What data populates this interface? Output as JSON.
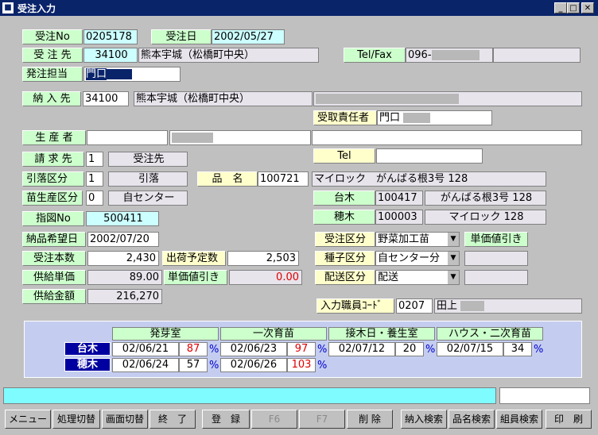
{
  "window": {
    "title": "受注入力"
  },
  "header": {
    "order_no_label": "受注No",
    "order_no": "0205178",
    "order_date_label": "受注日",
    "order_date": "2002/05/27",
    "customer_label": "受 注 先",
    "customer_code": "34100",
    "customer_name": "熊本宇城（松橋町中央）",
    "tel_label": "Tel/Fax",
    "tel": "096-",
    "contact_label": "発注担当",
    "contact_name": "門口"
  },
  "delivery": {
    "dest_label": "納 入 先",
    "dest_code": "34100",
    "dest_name": "熊本宇城（松橋町中央）",
    "receiver_label": "受取責任者",
    "receiver_name": "門口"
  },
  "producer": {
    "label": "生 産 者"
  },
  "billing": {
    "bill_label": "請 求 先",
    "bill_code": "1",
    "bill_name": "受注先",
    "tel_label": "Tel",
    "debit_label": "引落区分",
    "debit_code": "1",
    "debit_name": "引落",
    "product_label": "品　名",
    "product_code": "100721",
    "product_name": "マイロック　がんばる根3号 128",
    "seedling_label": "苗生産区分",
    "seedling_code": "0",
    "seedling_name": "自センター",
    "rootstock_label": "台木",
    "rootstock_code": "100417",
    "rootstock_name": "がんばる根3号 128",
    "instruction_label": "指図No",
    "instruction_no": "500411",
    "scion_label": "穂木",
    "scion_code": "100003",
    "scion_name": "マイロック 128"
  },
  "order": {
    "desired_date_label": "納品希望日",
    "desired_date": "2002/07/20",
    "order_type_label": "受注区分",
    "order_type": "野菜加工苗",
    "unit_discount_btn": "単価値引き",
    "qty_label": "受注本数",
    "qty": "2,430",
    "ship_qty_label": "出荷予定数",
    "ship_qty": "2,503",
    "seed_type_label": "種子区分",
    "seed_type": "自センター分",
    "unit_price_label": "供給単価",
    "unit_price": "89.00",
    "discount_label": "単価値引き",
    "discount": "0.00",
    "delivery_type_label": "配送区分",
    "delivery_type": "配送",
    "amount_label": "供給金額",
    "amount": "216,270",
    "staff_label": "入力職員ｺｰﾄﾞ",
    "staff_code": "0207",
    "staff_name": "田上"
  },
  "schedule": {
    "headers": [
      "発芽室",
      "一次育苗",
      "接木日・養生室",
      "ハウス・二次育苗"
    ],
    "rows": [
      {
        "label": "台木",
        "cells": [
          [
            "02/06/21",
            "87"
          ],
          [
            "02/06/23",
            "97"
          ],
          [
            "02/07/12",
            "20"
          ],
          [
            "02/07/15",
            "34"
          ]
        ]
      },
      {
        "label": "穂木",
        "cells": [
          [
            "02/06/24",
            "57"
          ],
          [
            "02/06/26",
            "103"
          ]
        ]
      }
    ],
    "pct": "%"
  },
  "footer_buttons": [
    "メニュー",
    "処理切替",
    "画面切替",
    "終　了",
    "登　録",
    "F6",
    "F7",
    "削 除",
    "納入検索",
    "品名検索",
    "組員検索",
    "印　刷"
  ]
}
